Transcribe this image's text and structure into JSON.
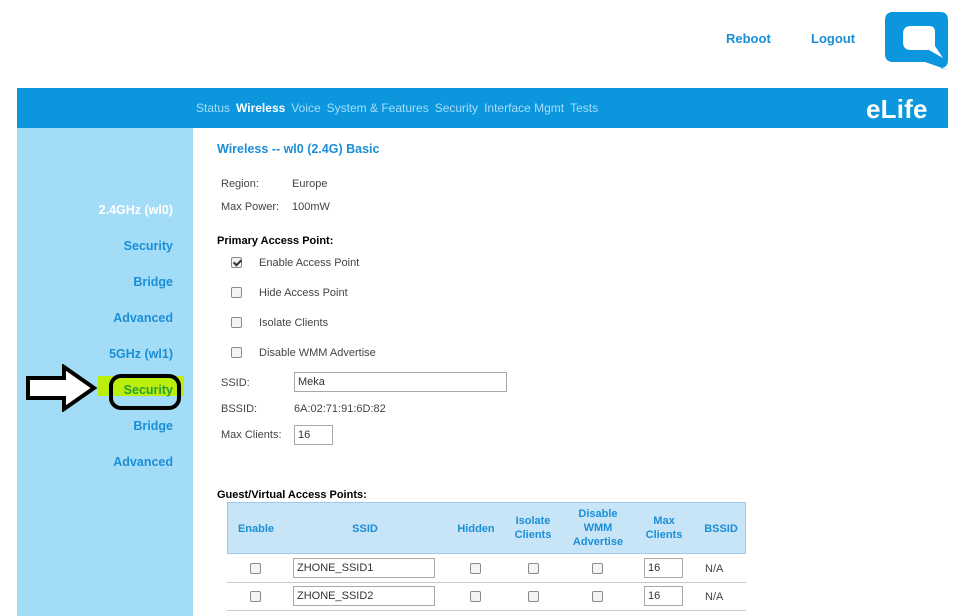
{
  "top": {
    "reboot": "Reboot",
    "logout": "Logout"
  },
  "header": {
    "brand": "eLife",
    "nav": [
      "Status",
      "Wireless",
      "Voice",
      "System & Features",
      "Security",
      "Interface Mgmt",
      "Tests"
    ],
    "active_nav": "Wireless"
  },
  "sidebar": {
    "items": [
      "2.4GHz (wl0)",
      "Security",
      "Bridge",
      "Advanced",
      "5GHz (wl1)",
      "Security",
      "Bridge",
      "Advanced"
    ]
  },
  "main": {
    "title": "Wireless -- wl0 (2.4G) Basic",
    "region_label": "Region:",
    "region_value": "Europe",
    "power_label": "Max Power:",
    "power_value": "100mW",
    "primary_heading": "Primary Access Point:",
    "options": [
      {
        "label": "Enable Access Point",
        "checked": true
      },
      {
        "label": "Hide Access Point",
        "checked": false
      },
      {
        "label": "Isolate Clients",
        "checked": false
      },
      {
        "label": "Disable WMM Advertise",
        "checked": false
      }
    ],
    "ssid_label": "SSID:",
    "ssid_value": "Meka",
    "bssid_label": "BSSID:",
    "bssid_value": "6A:02:71:91:6D:82",
    "maxclients_label": "Max Clients:",
    "maxclients_value": "16"
  },
  "guest": {
    "heading": "Guest/Virtual Access Points:",
    "columns": [
      "Enable",
      "SSID",
      "Hidden",
      "Isolate Clients",
      "Disable WMM Advertise",
      "Max Clients",
      "BSSID"
    ],
    "rows": [
      {
        "enable": false,
        "ssid": "ZHONE_SSID1",
        "hidden": false,
        "isolate": false,
        "disable_wmm": false,
        "max_clients": "16",
        "bssid": "N/A"
      },
      {
        "enable": false,
        "ssid": "ZHONE_SSID2",
        "hidden": false,
        "isolate": false,
        "disable_wmm": false,
        "max_clients": "16",
        "bssid": "N/A"
      }
    ]
  },
  "colors": {
    "header_blue": "#0b96de",
    "sidebar_blue": "#a3dcf7",
    "link_blue": "#1a8fd6",
    "highlight": "#b9ef0a"
  }
}
